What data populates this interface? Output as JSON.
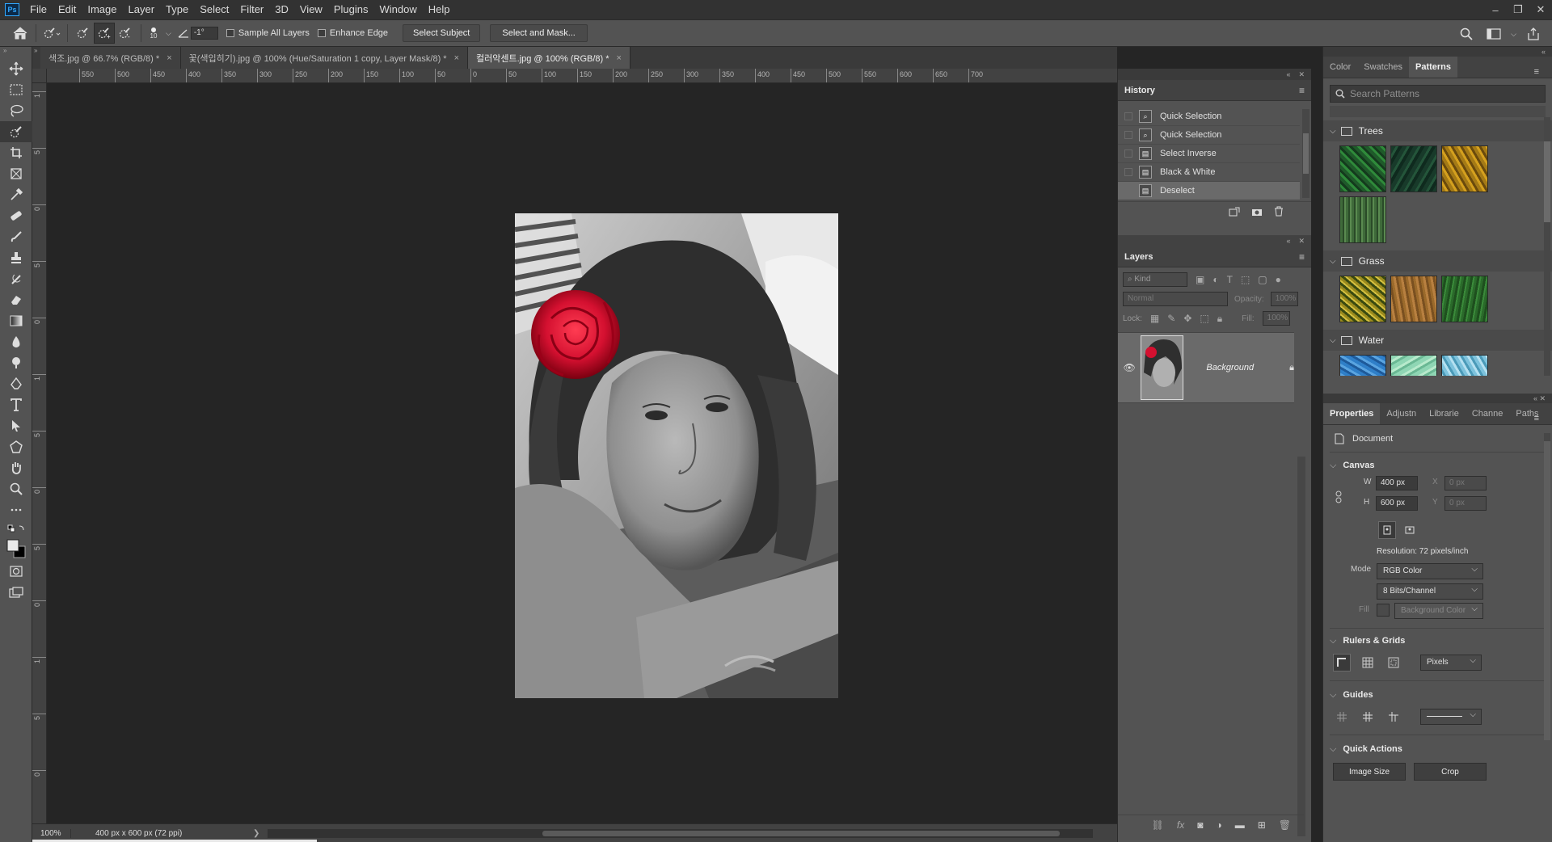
{
  "app": {
    "logo": "Ps"
  },
  "menu": [
    "File",
    "Edit",
    "Image",
    "Layer",
    "Type",
    "Select",
    "Filter",
    "3D",
    "View",
    "Plugins",
    "Window",
    "Help"
  ],
  "window_controls": [
    "–",
    "❐",
    "✕"
  ],
  "options": {
    "brush_size": "10",
    "angle": "-1°",
    "sample_all_layers": "Sample All Layers",
    "enhance_edge": "Enhance Edge",
    "select_subject": "Select Subject",
    "select_and_mask": "Select and Mask..."
  },
  "tabs": [
    {
      "label": "색조.jpg @ 66.7% (RGB/8) *",
      "close": "×"
    },
    {
      "label": "꽃(색입히기).jpg @ 100% (Hue/Saturation 1 copy, Layer Mask/8) *",
      "close": "×"
    },
    {
      "label": "컬러악센트.jpg @ 100% (RGB/8) *",
      "close": "×"
    }
  ],
  "ruler_h": [
    "550",
    "500",
    "450",
    "400",
    "350",
    "300",
    "250",
    "200",
    "150",
    "100",
    "50",
    "0",
    "50",
    "100",
    "150",
    "200",
    "250",
    "300",
    "350",
    "400",
    "450",
    "500",
    "550",
    "600",
    "650",
    "700"
  ],
  "ruler_v": [
    "1",
    "5",
    "0",
    "5",
    "0",
    "1",
    "5",
    "0",
    "5",
    "0",
    "1",
    "5",
    "0"
  ],
  "status": {
    "zoom": "100%",
    "doc": "400 px x 600 px (72 ppi)",
    "arrow": "❯"
  },
  "history": {
    "title": "History",
    "items": [
      {
        "label": "Quick Selection",
        "icon": "quick-selection-icon"
      },
      {
        "label": "Quick Selection",
        "icon": "quick-selection-icon"
      },
      {
        "label": "Select Inverse",
        "icon": "document-icon"
      },
      {
        "label": "Black & White",
        "icon": "document-icon"
      },
      {
        "label": "Deselect",
        "icon": "document-icon"
      }
    ]
  },
  "layers": {
    "title": "Layers",
    "kind": "Kind",
    "blend": "Normal",
    "opacity_label": "Opacity:",
    "opacity": "100%",
    "lock_label": "Lock:",
    "fill_label": "Fill:",
    "fill": "100%",
    "layer_name": "Background"
  },
  "right_tabs": [
    "Color",
    "Swatches",
    "Patterns"
  ],
  "patterns": {
    "search_placeholder": "Search Patterns",
    "groups": [
      {
        "name": "Trees",
        "colors": [
          "#1f5a2a",
          "#1b3b2c",
          "#a47a16",
          "#3f6a3a"
        ]
      },
      {
        "name": "Grass",
        "colors": [
          "#9a8a1d",
          "#9b6a2b",
          "#2a6a2a"
        ]
      },
      {
        "name": "Water",
        "colors": [
          "#2f7fc8",
          "#8fd6b4",
          "#7cc2dc"
        ]
      }
    ]
  },
  "properties": {
    "tabs": [
      "Properties",
      "Adjustn",
      "Librarie",
      "Channe",
      "Paths"
    ],
    "doc_label": "Document",
    "canvas": "Canvas",
    "w_label": "W",
    "w": "400 px",
    "h_label": "H",
    "h": "600 px",
    "x_label": "X",
    "x": "0 px",
    "y_label": "Y",
    "y": "0 px",
    "resolution": "Resolution: 72 pixels/inch",
    "mode_label": "Mode",
    "mode": "RGB Color",
    "bits": "8 Bits/Channel",
    "fill_label": "Fill",
    "fill": "Background Color",
    "rulers": "Rulers & Grids",
    "units": "Pixels",
    "guides": "Guides",
    "quick_actions": "Quick Actions",
    "image_size": "Image Size",
    "crop": "Crop"
  }
}
